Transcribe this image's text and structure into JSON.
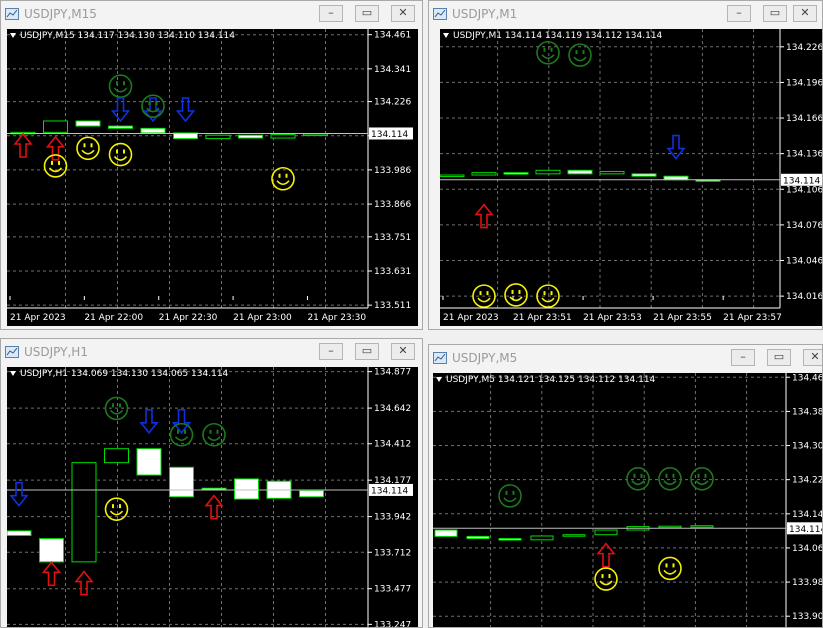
{
  "colors": {
    "chart_bg": "#000000",
    "grid": "#6f6f6f",
    "bull_fill": "#000000",
    "bear_fill": "#ffffff",
    "candle_border": "#00dd00",
    "bid_line": "#c0c0c0",
    "price_label_bg": "#ffffff",
    "axis_text": "#ffffff",
    "arrow_up": "#e01010",
    "arrow_down": "#1030e0",
    "smiley_yellow": "#f5f200",
    "smiley_green": "#1c7a1c"
  },
  "windows": [
    {
      "id": "m15",
      "title": "USDJPY,M15",
      "info": "USDJPY,M15  134.117 134.130 134.110 134.114",
      "price_labels": [
        "134.461",
        "134.341",
        "134.226",
        "134.106",
        "133.986",
        "133.866",
        "133.751",
        "133.631",
        "133.511"
      ],
      "current_price": "134.114",
      "time_labels": [
        "21 Apr 2023",
        "21 Apr 22:00",
        "21 Apr 22:30",
        "21 Apr 23:00",
        "21 Apr 23:30"
      ],
      "buttons": [
        "minimize",
        "maximize",
        "close"
      ],
      "icons": [
        "chart-window-icon"
      ],
      "candles": [
        {
          "o": 134.114,
          "c": 134.118
        },
        {
          "o": 134.118,
          "c": 134.158
        },
        {
          "o": 134.158,
          "c": 134.14
        },
        {
          "o": 134.14,
          "c": 134.132
        },
        {
          "o": 134.132,
          "c": 134.116
        },
        {
          "o": 134.116,
          "c": 134.096
        },
        {
          "o": 134.096,
          "c": 134.108
        },
        {
          "o": 134.108,
          "c": 134.098
        },
        {
          "o": 134.098,
          "c": 134.11
        },
        {
          "o": 134.11,
          "c": 134.112
        }
      ],
      "markers": [
        {
          "type": "arrow-up",
          "candle": 0,
          "price": 134.07
        },
        {
          "type": "arrow-up",
          "candle": 1,
          "price": 134.06
        },
        {
          "type": "smiley-yellow",
          "candle": 1,
          "price": 134.0
        },
        {
          "type": "smiley-yellow",
          "candle": 2,
          "price": 134.062
        },
        {
          "type": "smiley-green",
          "candle": 3,
          "price": 134.28
        },
        {
          "type": "arrow-down",
          "candle": 3,
          "price": 134.2
        },
        {
          "type": "smiley-yellow",
          "candle": 3,
          "price": 134.04
        },
        {
          "type": "arrow-down",
          "candle": 4,
          "price": 134.2
        },
        {
          "type": "smiley-green",
          "candle": 4,
          "price": 134.21
        },
        {
          "type": "arrow-down",
          "candle": 5,
          "price": 134.2
        },
        {
          "type": "smiley-yellow",
          "candle": 8,
          "price": 133.955
        }
      ]
    },
    {
      "id": "m1",
      "title": "USDJPY,M1",
      "info": "USDJPY,M1  134.114 134.119 134.112 134.114",
      "price_labels": [
        "134.226",
        "134.196",
        "134.166",
        "134.136",
        "134.106",
        "134.076",
        "134.046",
        "134.016"
      ],
      "current_price": "134.114",
      "time_labels": [
        "21 Apr 2023",
        "21 Apr 23:51",
        "21 Apr 23:53",
        "21 Apr 23:55",
        "21 Apr 23:57"
      ],
      "buttons": [
        "minimize",
        "maximize",
        "close"
      ],
      "icons": [
        "chart-window-icon"
      ],
      "candles": [
        {
          "o": 134.117,
          "c": 134.118
        },
        {
          "o": 134.118,
          "c": 134.12
        },
        {
          "o": 134.12,
          "c": 134.119
        },
        {
          "o": 134.119,
          "c": 134.122
        },
        {
          "o": 134.122,
          "c": 134.119
        },
        {
          "o": 134.119,
          "c": 134.121
        },
        {
          "o": 134.119,
          "c": 134.117
        },
        {
          "o": 134.117,
          "c": 134.114
        },
        {
          "o": 134.114,
          "c": 134.114
        }
      ],
      "markers": [
        {
          "type": "arrow-up",
          "candle": 1,
          "price": 134.083
        },
        {
          "type": "smiley-yellow",
          "candle": 1,
          "price": 134.016
        },
        {
          "type": "smiley-yellow",
          "candle": 2,
          "price": 134.017
        },
        {
          "type": "smiley-yellow",
          "candle": 3,
          "price": 134.016
        },
        {
          "type": "smiley-green",
          "candle": 3,
          "price": 134.221
        },
        {
          "type": "smiley-green",
          "candle": 4,
          "price": 134.219
        },
        {
          "type": "arrow-down",
          "candle": 7,
          "price": 134.142
        }
      ]
    },
    {
      "id": "h1",
      "title": "USDJPY,H1",
      "info": "USDJPY,H1  134.069 134.130 134.065 134.114",
      "price_labels": [
        "134.877",
        "134.642",
        "134.412",
        "134.177",
        "133.942",
        "133.712",
        "133.477",
        "133.247"
      ],
      "current_price": "134.114",
      "time_labels": [],
      "buttons": [
        "minimize",
        "maximize",
        "close"
      ],
      "icons": [
        "chart-window-icon"
      ],
      "candles": [
        {
          "o": 133.85,
          "c": 133.82
        },
        {
          "o": 133.8,
          "c": 133.65
        },
        {
          "o": 133.65,
          "c": 134.29
        },
        {
          "o": 134.29,
          "c": 134.38
        },
        {
          "o": 134.38,
          "c": 134.21
        },
        {
          "o": 134.26,
          "c": 134.07
        },
        {
          "o": 134.125,
          "c": 134.115
        },
        {
          "o": 134.185,
          "c": 134.055
        },
        {
          "o": 134.17,
          "c": 134.06
        },
        {
          "o": 134.11,
          "c": 134.07
        }
      ],
      "markers": [
        {
          "type": "arrow-down",
          "candle": 0,
          "price": 134.09
        },
        {
          "type": "arrow-up",
          "candle": 1,
          "price": 133.57
        },
        {
          "type": "arrow-up",
          "candle": 2,
          "price": 133.51
        },
        {
          "type": "smiley-green",
          "candle": 3,
          "price": 134.64
        },
        {
          "type": "smiley-yellow",
          "candle": 3,
          "price": 133.99
        },
        {
          "type": "arrow-down",
          "candle": 4,
          "price": 134.56
        },
        {
          "type": "arrow-down",
          "candle": 5,
          "price": 134.56
        },
        {
          "type": "smiley-green",
          "candle": 5,
          "price": 134.47
        },
        {
          "type": "smiley-green",
          "candle": 6,
          "price": 134.47
        },
        {
          "type": "arrow-up",
          "candle": 6,
          "price": 134.0
        }
      ]
    },
    {
      "id": "m5",
      "title": "USDJPY,M5",
      "info": "USDJPY,M5  134.121 134.125 134.112 134.114",
      "price_labels": [
        "134.468",
        "134.388",
        "134.308",
        "134.228",
        "134.148",
        "134.068",
        "133.988",
        "133.908"
      ],
      "current_price": "134.114",
      "time_labels": [],
      "buttons": [
        "minimize",
        "maximize",
        "close"
      ],
      "icons": [
        "chart-window-icon"
      ],
      "candles": [
        {
          "o": 134.11,
          "c": 134.095
        },
        {
          "o": 134.095,
          "c": 134.09
        },
        {
          "o": 134.09,
          "c": 134.087
        },
        {
          "o": 134.087,
          "c": 134.096
        },
        {
          "o": 134.096,
          "c": 134.099
        },
        {
          "o": 134.099,
          "c": 134.11
        },
        {
          "o": 134.11,
          "c": 134.118
        },
        {
          "o": 134.118,
          "c": 134.119
        },
        {
          "o": 134.117,
          "c": 134.12
        }
      ],
      "markers": [
        {
          "type": "smiley-green",
          "candle": 2,
          "price": 134.19
        },
        {
          "type": "arrow-up",
          "candle": 5,
          "price": 134.05
        },
        {
          "type": "smiley-yellow",
          "candle": 5,
          "price": 133.995
        },
        {
          "type": "smiley-green",
          "candle": 6,
          "price": 134.23
        },
        {
          "type": "smiley-green",
          "candle": 7,
          "price": 134.23
        },
        {
          "type": "smiley-green",
          "candle": 8,
          "price": 134.23
        },
        {
          "type": "smiley-yellow",
          "candle": 7,
          "price": 134.02
        }
      ]
    }
  ]
}
